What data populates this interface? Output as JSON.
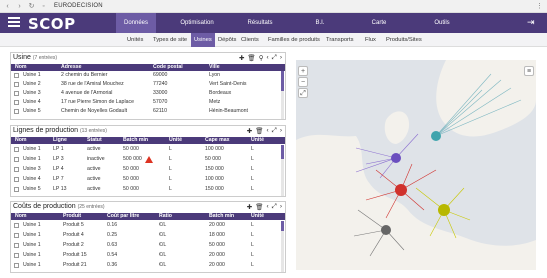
{
  "browser": {
    "url": "EURODECISION"
  },
  "app": {
    "logo": "SCOP",
    "exit_icon": "logout-icon",
    "accent": "#4b3a7a",
    "active_color": "#6d5ca5"
  },
  "topnav": [
    {
      "label": "Données",
      "active": true
    },
    {
      "label": "Optimisation",
      "active": false
    },
    {
      "label": "Résultats",
      "active": false
    },
    {
      "label": "B.I.",
      "active": false
    },
    {
      "label": "Carte",
      "active": false
    },
    {
      "label": "Outils",
      "active": false
    }
  ],
  "subnav": [
    {
      "label": "Unités",
      "active": false
    },
    {
      "label": "Types de site",
      "active": false
    },
    {
      "label": "Usines",
      "active": true
    },
    {
      "label": "Dépôts",
      "active": false
    },
    {
      "label": "Clients",
      "active": false
    },
    {
      "label": "Familles de produits",
      "active": false
    },
    {
      "label": "Transports",
      "active": false
    },
    {
      "label": "Flux",
      "active": false
    },
    {
      "label": "Produits/Sites",
      "active": false
    }
  ],
  "usines": {
    "title": "Usine",
    "count": "(7 entrées)",
    "columns": [
      "Nom",
      "Adresse",
      "Code postal",
      "Ville"
    ],
    "rows": [
      [
        "Usine 1",
        "2 chemin du Bernier",
        "69000",
        "Lyon"
      ],
      [
        "Usine 2",
        "38 rue de l'Amiral Mouchez",
        "77240",
        "Vert Saint-Denis"
      ],
      [
        "Usine 3",
        "4 avenue de l'Armorial",
        "33000",
        "Bordeaux"
      ],
      [
        "Usine 4",
        "17 rue Pierre Simon de Laplace",
        "57070",
        "Metz"
      ],
      [
        "Usine 5",
        "Chemin de Noyelles Godault",
        "62110",
        "Hénin-Beaumont"
      ]
    ]
  },
  "lignes": {
    "title": "Lignes de production",
    "count": "(13 entrées)",
    "columns": [
      "Nom",
      "Ligne",
      "Statut",
      "Batch min",
      "Unité",
      "Cape max",
      "Unité"
    ],
    "rows": [
      [
        "Usine 1",
        "LP 1",
        "active",
        "50 000",
        "L",
        "100 000",
        "L"
      ],
      [
        "Usine 1",
        "LP 3",
        "inactive",
        "500 000",
        "L",
        "50 000",
        "L"
      ],
      [
        "Usine 3",
        "LP 4",
        "active",
        "50 000",
        "L",
        "150 000",
        "L"
      ],
      [
        "Usine 4",
        "LP 7",
        "active",
        "50 000",
        "L",
        "100 000",
        "L"
      ],
      [
        "Usine 5",
        "LP 13",
        "active",
        "50 000",
        "L",
        "150 000",
        "L"
      ]
    ]
  },
  "couts": {
    "title": "Coûts de production",
    "count": "(25 entrées)",
    "columns": [
      "Nom",
      "Produit",
      "Coût par litre",
      "Ratio",
      "Batch min",
      "Unité"
    ],
    "rows": [
      [
        "Usine 1",
        "Produit 5",
        "0.16",
        "€/L",
        "20 000",
        "L"
      ],
      [
        "Usine 1",
        "Produit 4",
        "0.25",
        "€/L",
        "18 000",
        "L"
      ],
      [
        "Usine 1",
        "Produit 2",
        "0.63",
        "€/L",
        "50 000",
        "L"
      ],
      [
        "Usine 1",
        "Produit 15",
        "0.54",
        "€/L",
        "20 000",
        "L"
      ],
      [
        "Usine 1",
        "Produit 21",
        "0.36",
        "€/L",
        "20 000",
        "L"
      ]
    ]
  }
}
